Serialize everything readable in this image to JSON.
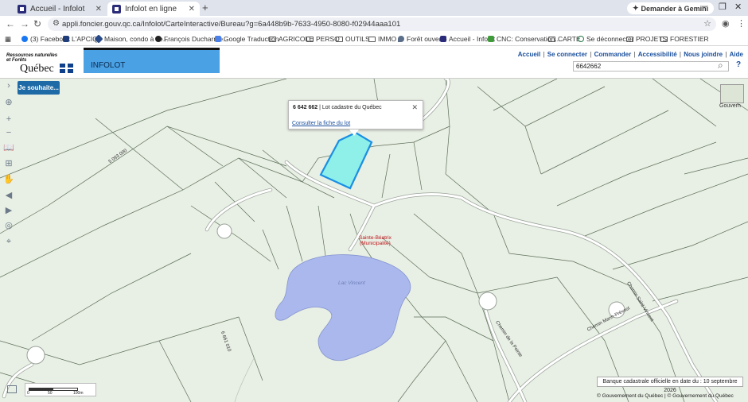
{
  "browser": {
    "tabs": [
      {
        "label": "Accueil - Infolot",
        "active": false
      },
      {
        "label": "Infolot en ligne",
        "active": true
      }
    ],
    "gemini_label": "Demander à Gemini",
    "url": "appli.foncier.gouv.qc.ca/Infolot/CarteInteractive/Bureau?g=6a448b9b-7633-4950-8080-f02944aaa101",
    "bookmarks": [
      "(3) Facebook",
      "L'APCIQ",
      "Maison, condo à ve...",
      "François Ducharme...",
      "Google Traduction",
      "AGRICOLE",
      "PERSO",
      "OUTILS",
      "IMMO",
      "Forêt ouverte",
      "Accueil - Infolot",
      "CNC: Conservation...",
      "CARTE",
      "Se déconnecter",
      "PROJETS",
      "FORESTIER"
    ]
  },
  "header": {
    "logo_line1": "Ressources naturelles",
    "logo_line2": "et Forêts",
    "logo_brand": "Québec",
    "app_title": "INFOLOT",
    "links": [
      "Accueil",
      "Se connecter",
      "Commander",
      "Accessibilité",
      "Nous joindre",
      "Aide"
    ],
    "search_value": "6642662"
  },
  "map": {
    "action_button": "Je souhaite...",
    "basemap_label": "Gouvern",
    "popup": {
      "lot_number": "6 642 662",
      "lot_desc": "| Lot cadastre du Québec",
      "link": "Consulter la fiche du lot"
    },
    "grid_label_1": "5 093 000",
    "grid_label_2": "6 661 010",
    "municipality": "Sainte-Béatrix",
    "municipality_type": "(Municipalité)",
    "lake_name": "Lac Vincent",
    "road_1": "Chemin de la Pointe",
    "road_2": "Chemin Marin-Prévost",
    "road_3": "Chemin Saint-Vincent",
    "scale": {
      "s0": "0",
      "s1": "50",
      "s2": "100m"
    },
    "date_info": "Banque cadastrale officielle en date du : 10 septembre 2026",
    "copyright": "© Gouvernement du Québec | © Gouvernement du Québec"
  },
  "colors": {
    "selected_lot_fill": "#8ef0e9",
    "selected_lot_stroke": "#1a8fe3",
    "lake": "#aab8ee",
    "map_bg": "#e8efe4",
    "banner": "#4aa1e4"
  }
}
